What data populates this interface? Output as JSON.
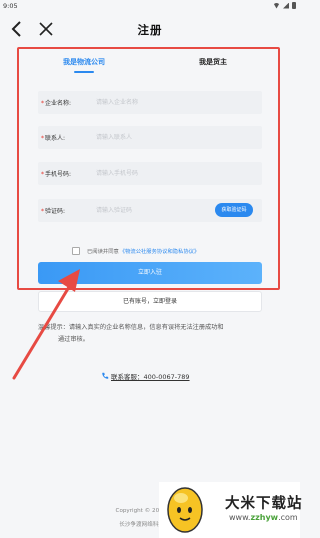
{
  "status": {
    "time": "9:05"
  },
  "header": {
    "title": "注册"
  },
  "tabs": [
    {
      "label": "我是物流公司",
      "active": true
    },
    {
      "label": "我是货主",
      "active": false
    }
  ],
  "form": {
    "fields": [
      {
        "label": "企业名称:",
        "placeholder": "请输入企业名称",
        "required": true
      },
      {
        "label": "联系人:",
        "placeholder": "请输入联系人",
        "required": true
      },
      {
        "label": "手机号码:",
        "placeholder": "请输入手机号码",
        "required": true
      },
      {
        "label": "验证码:",
        "placeholder": "请输入验证码",
        "required": true
      }
    ],
    "code_button": "获取验证码",
    "agreement_prefix": "已阅读并同意",
    "agreement_link": "《物流公社服务协议和隐私协议》",
    "submit_label": "立即入驻",
    "login_label": "已有账号，立即登录"
  },
  "notice": {
    "line1": "温馨提示：请输入真实的企业名称信息，信息有误将无法注册成功和",
    "line2": "通过审核。"
  },
  "contact": {
    "label": "联系客服：400-0067-789"
  },
  "footer": {
    "copyright": "Copyright © 2022 - All R",
    "company": "长沙争渡网络科技有限公"
  },
  "watermark": {
    "title": "大米下载站",
    "url_prefix": "www.",
    "url_brand": "zzhyw",
    "url_suffix": ".com"
  },
  "colors": {
    "accent": "#2b89ef",
    "highlight": "#e74a43"
  }
}
